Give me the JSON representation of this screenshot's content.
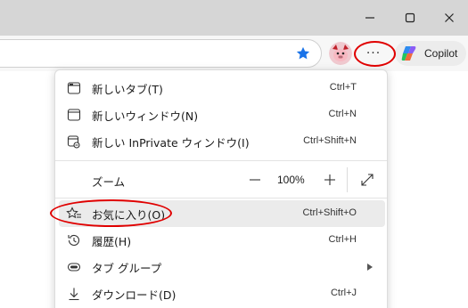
{
  "window": {
    "minimize_icon": "minimize-icon",
    "maximize_icon": "maximize-icon",
    "close_icon": "close-icon"
  },
  "toolbar": {
    "favorite_icon": "star-filled-icon",
    "accent_color": "#1a73e8",
    "more_label": "···",
    "copilot_label": "Copilot"
  },
  "menu": {
    "items": [
      {
        "label": "新しいタブ(T)",
        "shortcut": "Ctrl+T",
        "icon": "new-tab-icon"
      },
      {
        "label": "新しいウィンドウ(N)",
        "shortcut": "Ctrl+N",
        "icon": "new-window-icon"
      },
      {
        "label": "新しい InPrivate ウィンドウ(I)",
        "shortcut": "Ctrl+Shift+N",
        "icon": "inprivate-icon"
      }
    ],
    "zoom": {
      "label": "ズーム",
      "minus": "—",
      "level": "100%",
      "plus": "+"
    },
    "items2": [
      {
        "label": "お気に入り(O)",
        "shortcut": "Ctrl+Shift+O",
        "icon": "favorites-icon",
        "highlighted": true
      },
      {
        "label": "履歴(H)",
        "shortcut": "Ctrl+H",
        "icon": "history-icon"
      },
      {
        "label": "タブ グループ",
        "shortcut": "",
        "icon": "tab-groups-icon",
        "has_submenu": true
      },
      {
        "label": "ダウンロード(D)",
        "shortcut": "Ctrl+J",
        "icon": "download-icon"
      }
    ]
  },
  "annotation_color": "#e00000"
}
